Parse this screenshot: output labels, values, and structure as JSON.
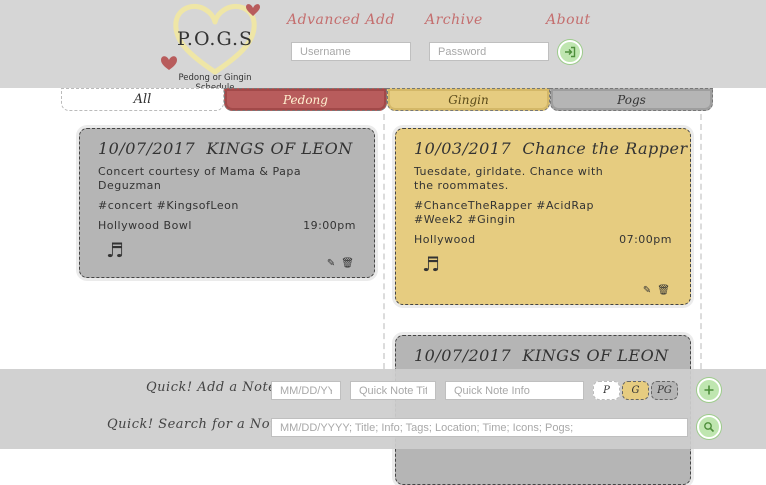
{
  "header": {
    "logo_letters": "P.O.G.S",
    "logo_subtitle": "Pedong or Gingin Schedule",
    "nav": [
      "Advanced Add",
      "Archive",
      "About"
    ],
    "username_placeholder": "Username",
    "password_placeholder": "Password",
    "login_icon": "sign-in-icon"
  },
  "tabs": [
    "All",
    "Pedong",
    "Gingin",
    "Pogs"
  ],
  "colors": {
    "pedong": "#b85c5c",
    "gingin": "#e6cc80",
    "pogs": "#b5b5b5",
    "accent_text": "#c46e6e",
    "button_green": "#bfe6b0"
  },
  "cards": [
    {
      "date": "10/07/2017",
      "title": "KINGS OF LEON",
      "info": "Concert courtesy of Mama & Papa Deguzman",
      "tags": "#concert #KingsofLeon",
      "location": "Hollywood Bowl",
      "time": "19:00pm",
      "icon": "music-note-icon",
      "owner": "Pogs"
    },
    {
      "date": "10/03/2017",
      "title": "Chance the Rapper",
      "info": "Tuesdate, girldate. Chance with the roommates.",
      "tags": "#ChanceTheRapper #AcidRap #Week2 #Gingin",
      "location": "Hollywood",
      "time": "07:00pm",
      "icon": "music-note-icon",
      "owner": "Gingin"
    },
    {
      "date": "10/07/2017",
      "title": "KINGS OF LEON",
      "owner": "Pogs"
    }
  ],
  "card_actions": {
    "edit_icon": "pencil-icon",
    "delete_icon": "trash-icon"
  },
  "quick_add": {
    "label": "Quick! Add a Note",
    "date_placeholder": "MM/DD/YYYY",
    "title_placeholder": "Quick Note Title",
    "info_placeholder": "Quick Note Info",
    "owners": [
      "P",
      "G",
      "PG"
    ],
    "selected_owner": "G",
    "add_icon": "plus-icon"
  },
  "quick_search": {
    "label": "Quick! Search for a Note",
    "placeholder": "MM/DD/YYYY; Title; Info; Tags; Location; Time; Icons; Pogs;",
    "search_icon": "search-icon"
  }
}
